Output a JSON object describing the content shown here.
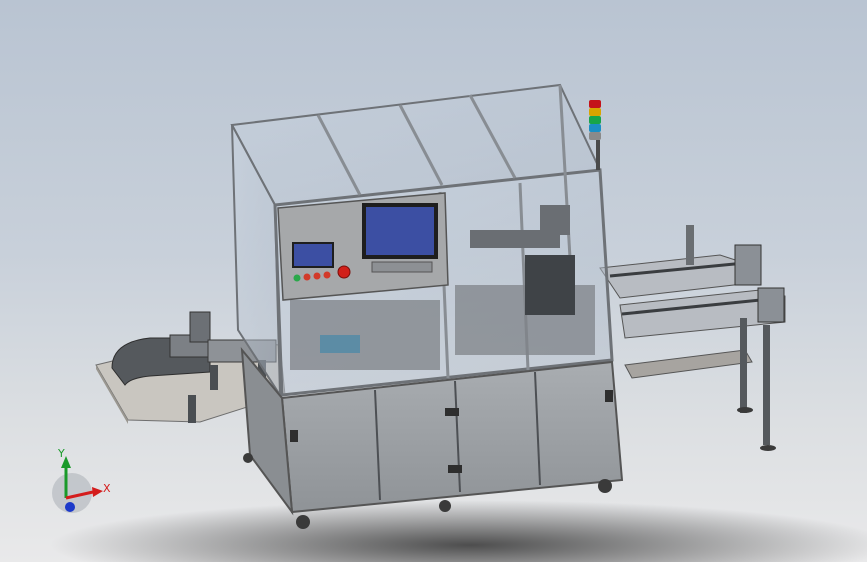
{
  "axes": {
    "x_label": "X",
    "y_label": "Y"
  },
  "stack_light_colors": [
    "#c4121a",
    "#d9a400",
    "#18a54a",
    "#1c8fc4",
    "#8a8a8a"
  ],
  "lamp_colors": [
    "#2aa84a",
    "#d23a2a",
    "#d23a2a",
    "#d23a2a"
  ],
  "estop_color": "#d1201a",
  "screen_color": "#3c4fa3",
  "frame_color": "#9aa0a8",
  "cabinet_color": "#9fa3a7"
}
